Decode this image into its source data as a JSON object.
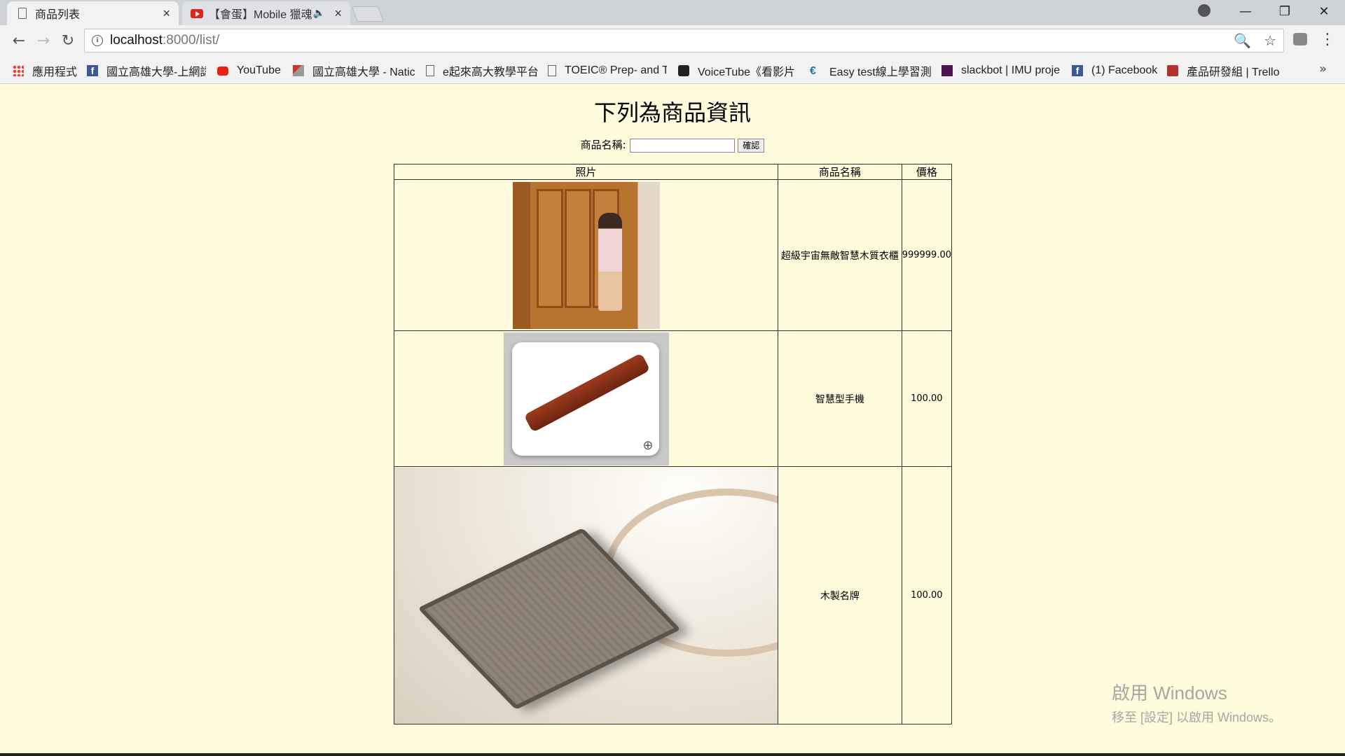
{
  "browser": {
    "tabs": [
      {
        "title": "商品列表",
        "close": "×"
      },
      {
        "title": "【會蛋】Mobile 獵魂",
        "close": "×"
      }
    ],
    "window_controls": {
      "minimize": "—",
      "restore": "❐",
      "close": "✕"
    },
    "url": {
      "host": "localhost",
      "path": ":8000/list/"
    },
    "bookmarks": [
      {
        "label": "應用程式",
        "icon": "apps-icon"
      },
      {
        "label": "國立高雄大學-上網認",
        "icon": "facebook-icon"
      },
      {
        "label": "YouTube",
        "icon": "youtube-icon"
      },
      {
        "label": "國立高雄大學 - Natic",
        "icon": "nuk-icon"
      },
      {
        "label": "e起來高大教學平台",
        "icon": "document-icon"
      },
      {
        "label": "TOEIC® Prep- and T",
        "icon": "document-icon"
      },
      {
        "label": "VoiceTube《看影片",
        "icon": "voicetube-icon"
      },
      {
        "label": "Easy test線上學習測",
        "icon": "easytest-icon"
      },
      {
        "label": "slackbot | IMU proje",
        "icon": "slack-icon"
      },
      {
        "label": "(1) Facebook",
        "icon": "facebook-icon"
      },
      {
        "label": "產品研發組 | Trello",
        "icon": "trello-icon"
      }
    ],
    "bookmarks_more": "»"
  },
  "page": {
    "title": "下列為商品資訊",
    "search": {
      "label": "商品名稱:",
      "value": "",
      "button": "確認"
    },
    "table": {
      "headers": [
        "照片",
        "商品名稱",
        "價格"
      ],
      "rows": [
        {
          "name": "超級宇宙無敵智慧木質衣櫃",
          "price": "999999.00"
        },
        {
          "name": "智慧型手機",
          "price": "100.00"
        },
        {
          "name": "木製名牌",
          "price": "100.00"
        }
      ]
    }
  },
  "watermark": {
    "line1": "啟用 Windows",
    "line2": "移至 [設定] 以啟用 Windows。"
  }
}
